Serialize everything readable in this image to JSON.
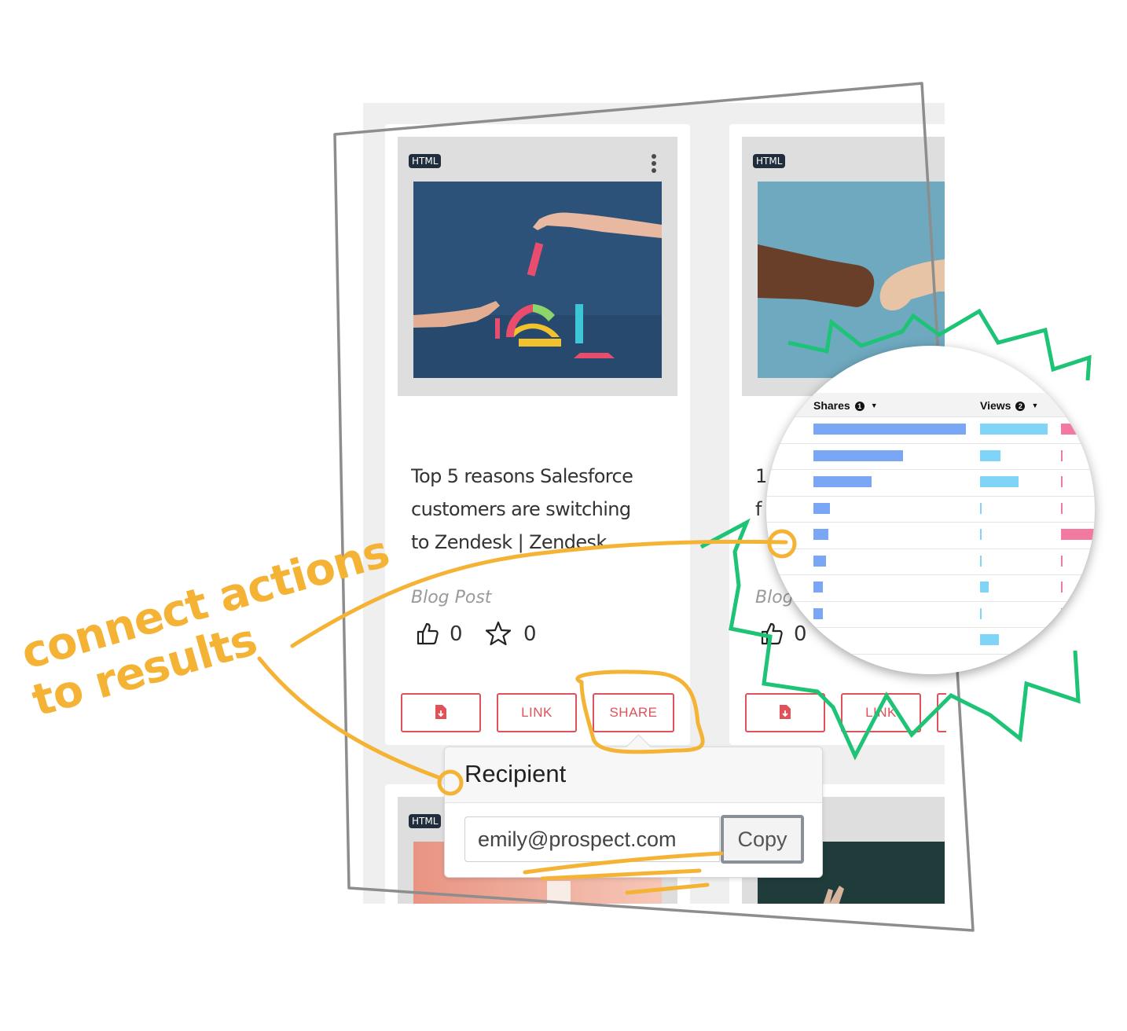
{
  "cards": [
    {
      "badge": "HTML",
      "title_lines": [
        "Top 5 reasons Salesforce",
        "customers are switching",
        "to Zendesk | Zendesk"
      ],
      "type": "Blog Post",
      "likes": "0",
      "favorites": "0",
      "buttons": {
        "link": "LINK",
        "share": "SHARE"
      }
    },
    {
      "badge": "HTML",
      "title_lines": [
        "1",
        "f"
      ],
      "type": "Blog",
      "likes": "0",
      "buttons": {
        "link": "LINK"
      }
    },
    {
      "badge": "HTML"
    }
  ],
  "popover": {
    "title": "Recipient",
    "email_value": "emily@prospect.com",
    "copy_label": "Copy"
  },
  "magnifier": {
    "columns": [
      "Shares",
      "Views"
    ],
    "shares": [
      1.0,
      0.59,
      0.38,
      0.11,
      0.1,
      0.08,
      0.06,
      0.06
    ],
    "views": [
      1.0,
      0.3,
      0.57,
      0.02,
      0.02,
      0.02,
      0.13,
      0.02,
      0.28
    ],
    "third": [
      0.3,
      0.03,
      0.03,
      0.03,
      0.6,
      0.03,
      0.03,
      0.03
    ],
    "colors": {
      "shares": "#7aa7f5",
      "views": "#7fd4f7",
      "third": "#f27aa0"
    }
  },
  "annotation": {
    "line1": "connect actions",
    "line2": "to results",
    "color": "#f5b335"
  },
  "colors": {
    "accent": "#e0525a",
    "burst": "#1ec476",
    "frame": "#8d8d8d"
  }
}
